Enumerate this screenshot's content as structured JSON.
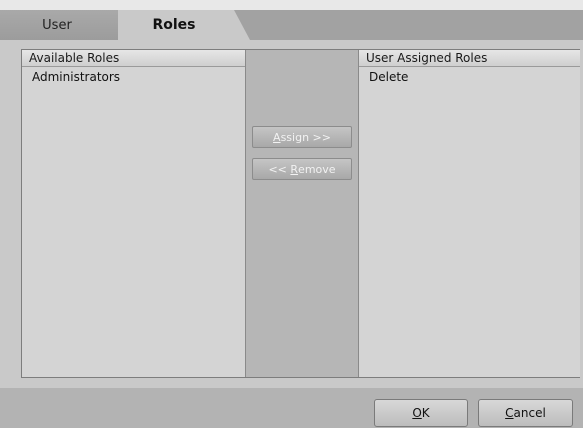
{
  "tabs": [
    {
      "label": "User",
      "active": false
    },
    {
      "label": "Roles",
      "active": true
    }
  ],
  "available": {
    "header": "Available Roles",
    "items": [
      "Administrators"
    ]
  },
  "assigned": {
    "header": "User Assigned Roles",
    "items": [
      "Delete"
    ]
  },
  "actions": {
    "assign_mnemonic": "A",
    "assign_rest": "ssign >>",
    "remove_prefix": "<< ",
    "remove_mnemonic": "R",
    "remove_rest": "emove",
    "enabled": false
  },
  "footer": {
    "ok_mnemonic": "O",
    "ok_rest": "K",
    "cancel_mnemonic": "C",
    "cancel_rest": "ancel"
  }
}
